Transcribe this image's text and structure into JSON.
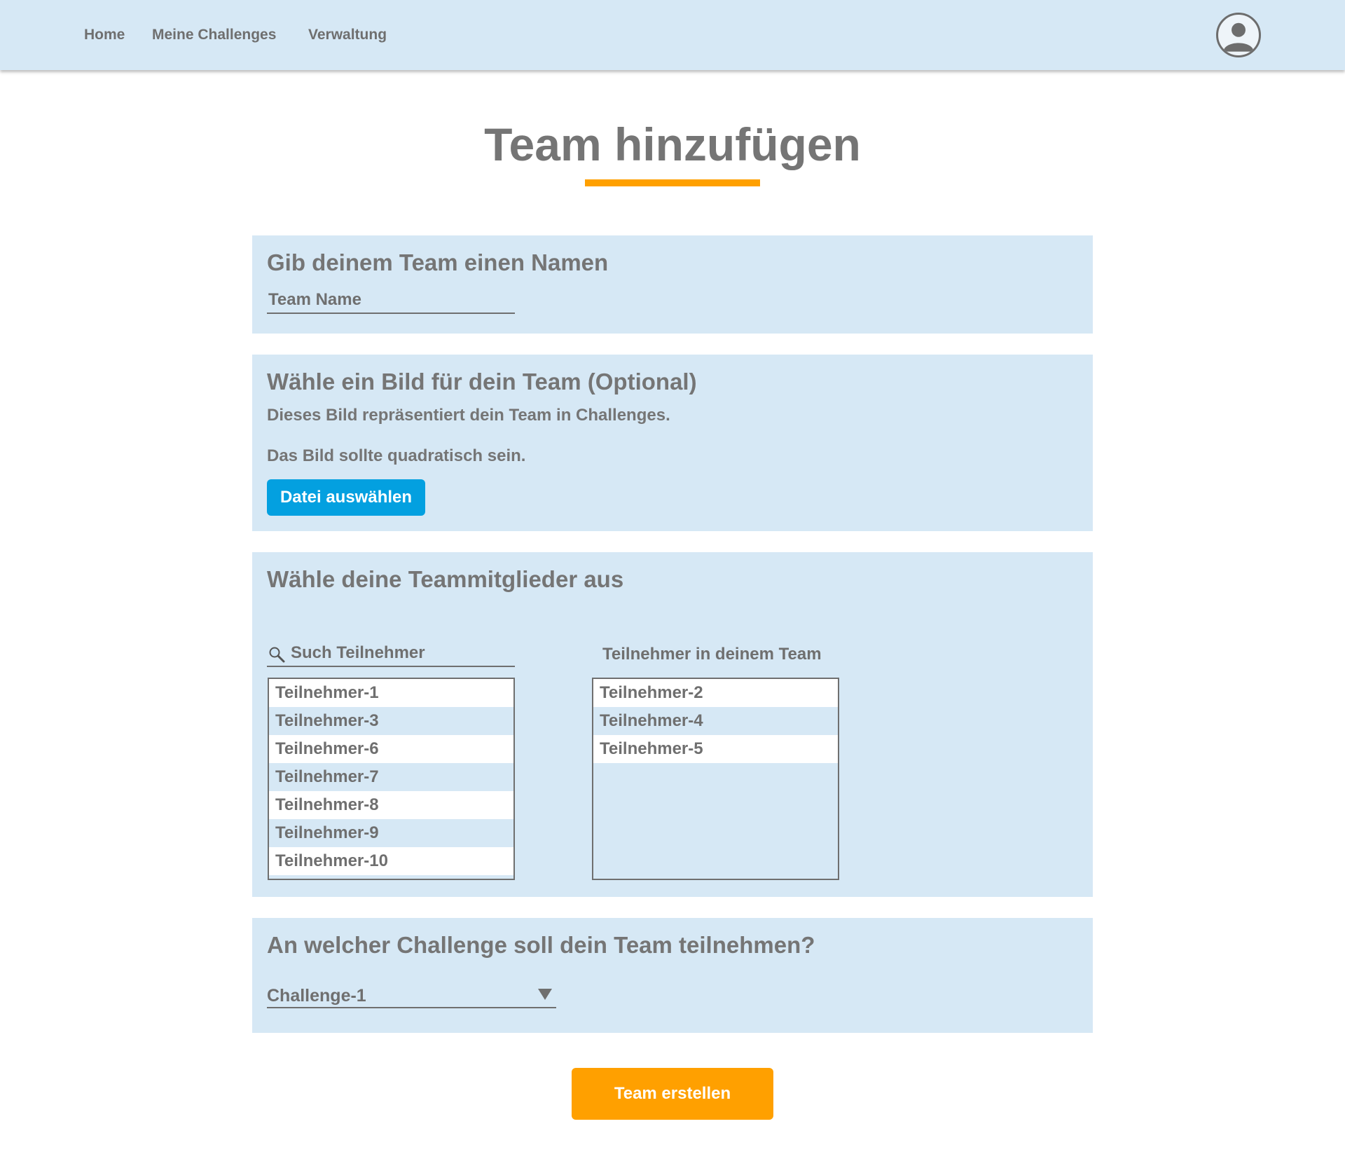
{
  "nav": {
    "links": [
      "Home",
      "Meine Challenges",
      "Verwaltung"
    ],
    "avatar_icon": "user-avatar-icon"
  },
  "page": {
    "title": "Team hinzufügen",
    "accent_color": "#ffa000",
    "panel_color": "#d6e8f5"
  },
  "name_section": {
    "heading": "Gib deinem Team einen Namen",
    "input_placeholder": "Team Name"
  },
  "image_section": {
    "heading": "Wähle ein Bild für dein Team (Optional)",
    "text_1": "Dieses Bild repräsentiert dein Team in Challenges.",
    "text_2": "Das Bild sollte quadratisch sein.",
    "button_label": "Datei auswählen",
    "button_color": "#03a0e0"
  },
  "members_section": {
    "heading": "Wähle deine Teammitglieder aus",
    "search_placeholder": "Such Teilnehmer",
    "search_icon": "magnifier-icon",
    "team_label": "Teilnehmer in deinem Team",
    "available": [
      "Teilnehmer-1",
      "Teilnehmer-3",
      "Teilnehmer-6",
      "Teilnehmer-7",
      "Teilnehmer-8",
      "Teilnehmer-9",
      "Teilnehmer-10"
    ],
    "selected": [
      "Teilnehmer-2",
      "Teilnehmer-4",
      "Teilnehmer-5"
    ]
  },
  "challenge_section": {
    "heading": "An welcher Challenge soll dein Team teilnehmen?",
    "selected_challenge": "Challenge-1",
    "dropdown_icon": "triangle-down-icon"
  },
  "submit": {
    "label": "Team erstellen"
  }
}
